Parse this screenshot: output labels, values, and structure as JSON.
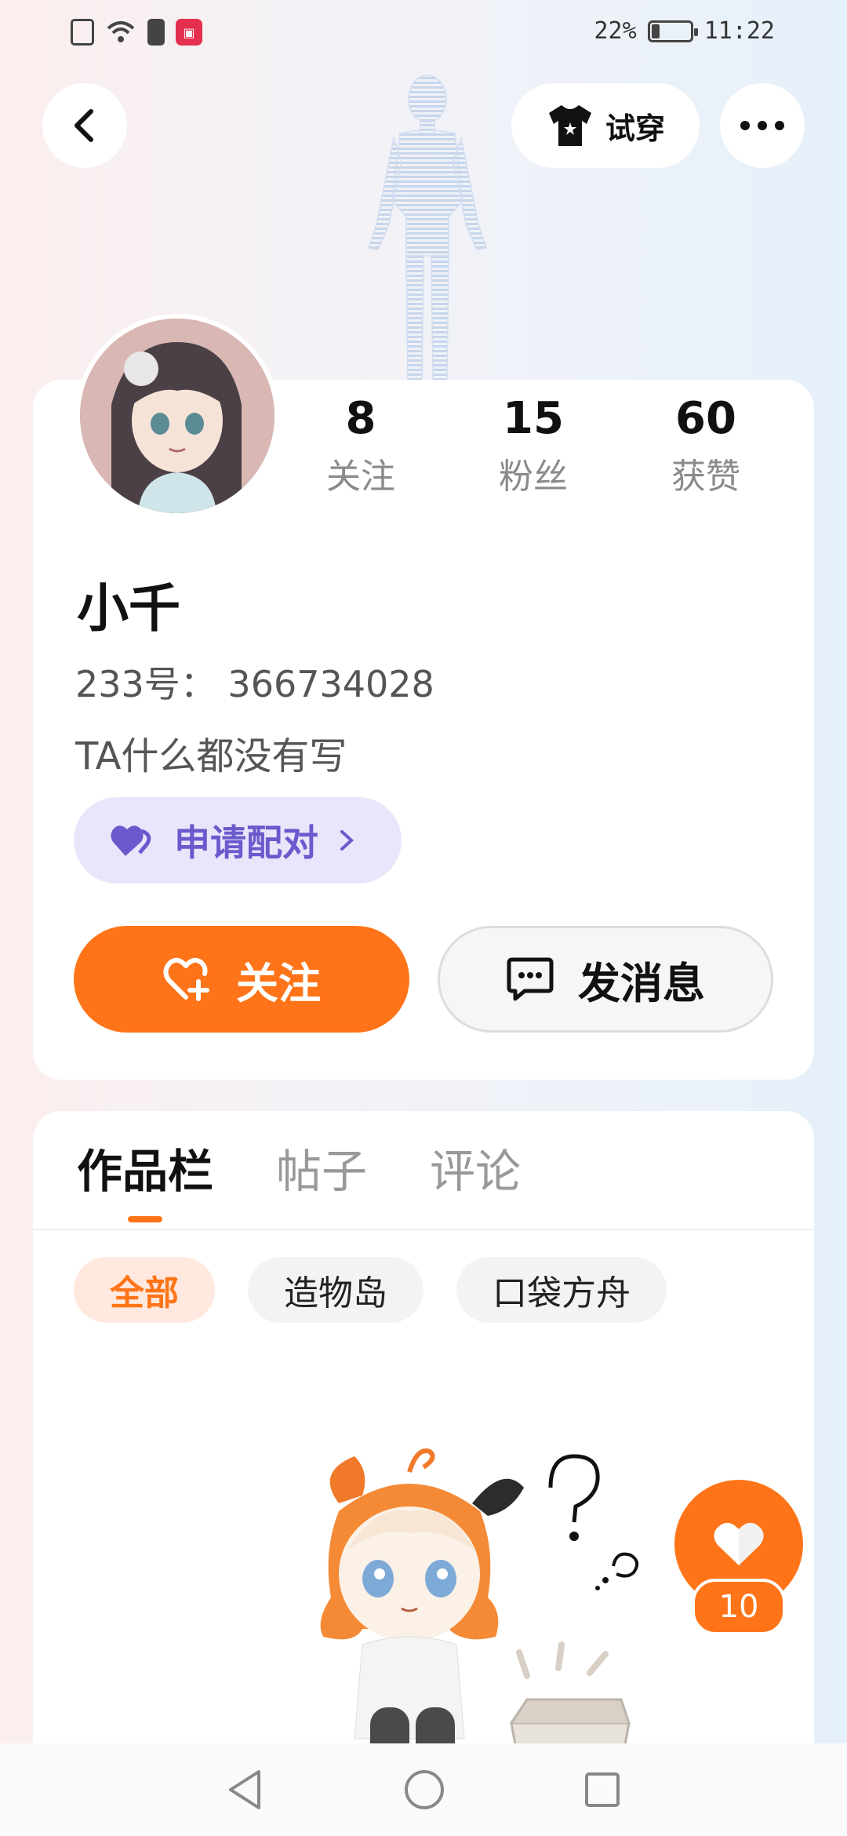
{
  "status_bar": {
    "battery_percent": "22%",
    "battery_level": 0.22,
    "time": "11:22"
  },
  "header": {
    "try_on_label": "试穿"
  },
  "profile": {
    "stats": [
      {
        "num": "8",
        "label": "关注"
      },
      {
        "num": "15",
        "label": "粉丝"
      },
      {
        "num": "60",
        "label": "获赞"
      }
    ],
    "name": "小千",
    "uid": "233号： 366734028",
    "bio": "TA什么都没有写",
    "pair_label": "申请配对",
    "follow_label": "关注",
    "message_label": "发消息"
  },
  "works": {
    "tabs": [
      "作品栏",
      "帖子",
      "评论"
    ],
    "filters": [
      "全部",
      "造物岛",
      "口袋方舟"
    ]
  },
  "like": {
    "count": "10"
  },
  "colors": {
    "accent": "#ff7418",
    "pair_purple": "#6a5acd",
    "pair_bg": "#e9e6fb"
  },
  "icons": [
    "back-icon",
    "tshirt-icon",
    "more-icon",
    "heart-icon",
    "chevron-right-icon",
    "heart-plus-icon",
    "chat-icon",
    "nav-back-icon",
    "nav-home-icon",
    "nav-recents-icon"
  ]
}
